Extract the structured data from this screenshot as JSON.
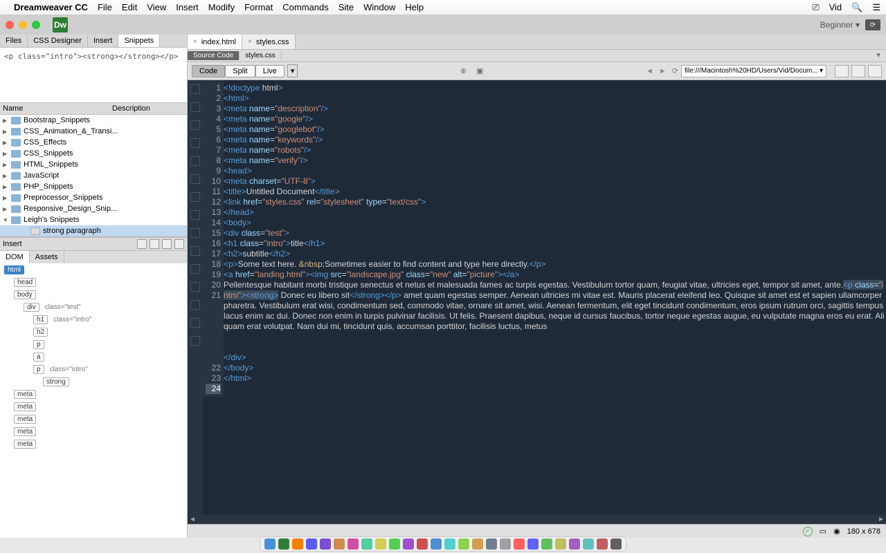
{
  "menu": {
    "app": "Dreamweaver CC",
    "items": [
      "File",
      "Edit",
      "View",
      "Insert",
      "Modify",
      "Format",
      "Commands",
      "Site",
      "Window",
      "Help"
    ],
    "user": "Vid"
  },
  "titlebar": {
    "logo": "Dw",
    "mode": "Beginner"
  },
  "leftTabs": [
    "Files",
    "CSS Designer",
    "Insert",
    "Snippets"
  ],
  "leftTabActive": "Snippets",
  "snippetPreview": "<p class=\"intro\"><strong></strong></p>",
  "listHeaders": {
    "c1": "Name",
    "c2": "Description"
  },
  "snippets": [
    {
      "label": "Bootstrap_Snippets",
      "folder": true
    },
    {
      "label": "CSS_Animation_&_Transi...",
      "folder": true
    },
    {
      "label": "CSS_Effects",
      "folder": true
    },
    {
      "label": "CSS_Snippets",
      "folder": true
    },
    {
      "label": "HTML_Snippets",
      "folder": true
    },
    {
      "label": "JavaScript",
      "folder": true
    },
    {
      "label": "PHP_Snippets",
      "folder": true
    },
    {
      "label": "Preprocessor_Snippets",
      "folder": true
    },
    {
      "label": "Responsive_Design_Snip...",
      "folder": true
    },
    {
      "label": "Leigh's Snippets",
      "folder": true,
      "open": true
    },
    {
      "label": "strong paragraph",
      "folder": false,
      "indent": 2,
      "selected": true
    }
  ],
  "insertLabel": "Insert",
  "domAssetsTabs": [
    "DOM",
    "Assets"
  ],
  "domAssetsActive": "DOM",
  "dom": [
    {
      "tag": "html",
      "d": 0,
      "sel": true
    },
    {
      "tag": "head",
      "d": 1
    },
    {
      "tag": "body",
      "d": 1
    },
    {
      "tag": "div",
      "d": 2,
      "attr": "class=\"test\""
    },
    {
      "tag": "h1",
      "d": 3,
      "attr": "class=\"intro\""
    },
    {
      "tag": "h2",
      "d": 3
    },
    {
      "tag": "p",
      "d": 3
    },
    {
      "tag": "a",
      "d": 3
    },
    {
      "tag": "p",
      "d": 3,
      "attr": "class=\"intro\""
    },
    {
      "tag": "strong",
      "d": 4
    },
    {
      "tag": "meta",
      "d": 1
    },
    {
      "tag": "meta",
      "d": 1
    },
    {
      "tag": "meta",
      "d": 1
    },
    {
      "tag": "meta",
      "d": 1
    },
    {
      "tag": "meta",
      "d": 1
    }
  ],
  "docTabs": [
    {
      "label": "index.html",
      "active": true
    },
    {
      "label": "styles.css"
    }
  ],
  "srcTabs": [
    {
      "label": "Source Code",
      "active": true
    },
    {
      "label": "styles.css"
    }
  ],
  "viewBtns": [
    "Code",
    "Split",
    "Live"
  ],
  "viewActive": "Code",
  "url": "file:///Macintosh%20HD/Users/Vid/Docum...",
  "status": {
    "dims": "180 x 678"
  },
  "lines": 24,
  "currentLine": 24,
  "code": {
    "l1": [
      "<!doctype ",
      "html",
      ">"
    ],
    "l2": [
      "<html>"
    ],
    "l3": [
      "<meta ",
      "name",
      "=",
      "\"description\"",
      "/>"
    ],
    "l4": [
      "<meta ",
      "name",
      "=",
      "\"google\"",
      "/>"
    ],
    "l5": [
      "<meta ",
      "name",
      "=",
      "\"googlebot\"",
      "/>"
    ],
    "l6": [
      "<meta ",
      "name",
      "=",
      "\"keywords\"",
      "/>"
    ],
    "l7": [
      "<meta ",
      "name",
      "=",
      "\"robots\"",
      "/>"
    ],
    "l8": [
      "<meta ",
      "name",
      "=",
      "\"verify\"",
      "/>"
    ],
    "l9": [
      "<head>"
    ],
    "l10": [
      "<meta ",
      "charset",
      "=",
      "\"UTF-8\"",
      ">"
    ],
    "l11": [
      "<title>",
      "Untitled Document",
      "</title>"
    ],
    "l12": [
      "<link ",
      "href",
      "=",
      "\"styles.css\"",
      " ",
      "rel",
      "=",
      "\"stylesheet\"",
      " ",
      "type",
      "=",
      "\"text/css\"",
      ">"
    ],
    "l13": [
      "</head>"
    ],
    "l14": [
      ""
    ],
    "l15": [
      "<body>"
    ],
    "l16": [
      "<div ",
      "class",
      "=",
      "\"test\"",
      ">"
    ],
    "l17": [
      "<h1 ",
      "class",
      "=",
      "\"intro\"",
      ">",
      "title",
      "</h1>"
    ],
    "l18": [
      "<h2>",
      "subtitle",
      "</h2>"
    ],
    "l19": [
      "<p>",
      "Some text here. ",
      "&nbsp;",
      "Sometimes easier to find content and type here directly.",
      "</p>"
    ],
    "l20": [
      "<a ",
      "href",
      "=",
      "\"landing.html\"",
      ">",
      "<img ",
      "src",
      "=",
      "\"landscape.jpg\"",
      " ",
      "class",
      "=",
      "\"new\"",
      " ",
      "alt",
      "=",
      "\"picture\"",
      ">",
      "</a>"
    ],
    "l21": "Pellentesque habitant morbi tristique senectus et netus et malesuada fames ac turpis egestas. Vestibulum tortor quam, feugiat vitae, ultricies eget, tempor sit amet, ante.<p class=\"intro\"><strong> Donec eu libero sit</strong></p> amet quam egestas semper. Aenean ultricies mi vitae est. Mauris placerat eleifend leo. Quisque sit amet est et sapien ullamcorper pharetra. Vestibulum erat wisi, condimentum sed, commodo vitae, ornare sit amet, wisi. Aenean fermentum, elit eget tincidunt condimentum, eros ipsum rutrum orci, sagittis tempus lacus enim ac dui. Donec non enim in turpis pulvinar facilisis. Ut felis. Praesent dapibus, neque id cursus faucibus, tortor neque egestas augue, eu vulputate magna eros eu erat. Aliquam erat volutpat. Nam dui mi, tincidunt quis, accumsan porttitor, facilisis luctus, metus",
    "l22": [
      "</div>"
    ],
    "l23": [
      "</body>"
    ],
    "l24": [
      "</html>"
    ]
  },
  "dockColors": [
    "#4a90d9",
    "#2e7d32",
    "#ff7f00",
    "#5a5aee",
    "#7b4fd0",
    "#d08b4f",
    "#d04f9f",
    "#4fd0a0",
    "#d0cf4f",
    "#4fd04f",
    "#a04fd0",
    "#d04f4f",
    "#4f8fd0",
    "#4fd0d0",
    "#8fd04f",
    "#d0a04f",
    "#708090",
    "#a0a0a0",
    "#ff6060",
    "#6060ff",
    "#60c060",
    "#c0c060",
    "#a060c0",
    "#60c0c0",
    "#c06060",
    "#606060"
  ]
}
